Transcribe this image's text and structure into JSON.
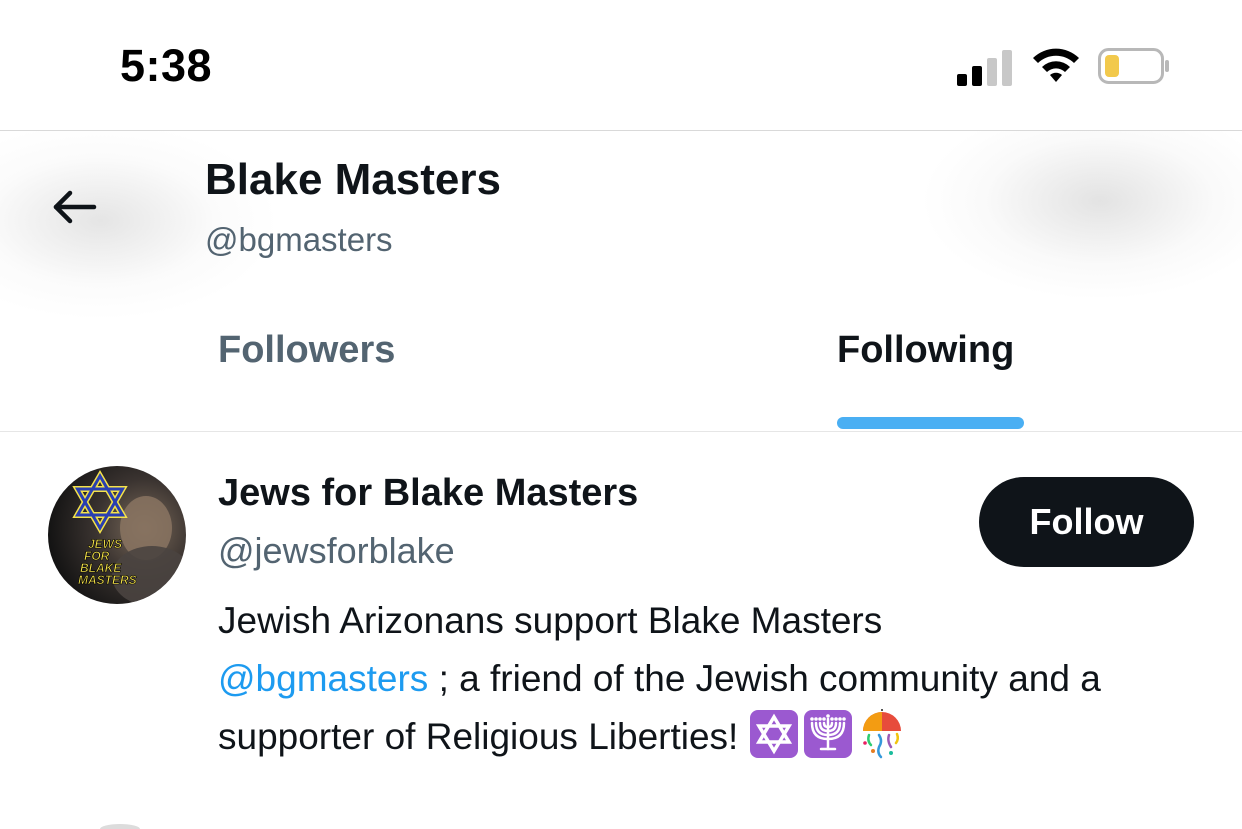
{
  "status_bar": {
    "time": "5:38",
    "signal_icon": "cellular-signal-icon",
    "wifi_icon": "wifi-icon",
    "battery_icon": "battery-low-icon",
    "battery_color": "#f2c94c"
  },
  "header": {
    "back_icon": "back-arrow-icon",
    "name": "Blake Masters",
    "handle": "@bgmasters"
  },
  "tabs": [
    {
      "label": "Followers",
      "active": false
    },
    {
      "label": "Following",
      "active": true
    }
  ],
  "users": [
    {
      "name": "Jews for Blake Masters",
      "handle": "@jewsforblake",
      "follow_label": "Follow",
      "avatar_text": [
        "JEWS",
        "FOR",
        "BLAKE",
        "MASTERS"
      ],
      "bio_text_1": "Jewish Arizonans support Blake Masters",
      "bio_mention": "@bgmasters",
      "bio_text_2": " ; a friend of the Jewish community and a supporter of Religious Liberties! ",
      "bio_emojis": [
        "star-of-david-icon",
        "menorah-icon",
        "confetti-ball-icon"
      ]
    }
  ],
  "colors": {
    "accent": "#1d9bf0",
    "primary_text": "#0f1419",
    "secondary_text": "#536471",
    "follow_button_bg": "#0f1419"
  }
}
